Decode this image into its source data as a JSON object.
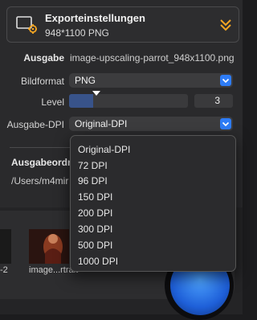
{
  "header": {
    "title": "Exporteinstellungen",
    "subtitle": "948*1100 PNG"
  },
  "ausgabe": {
    "label": "Ausgabe",
    "value": "image-upscaling-parrot_948x1100.png"
  },
  "bildformat": {
    "label": "Bildformat",
    "value": "PNG"
  },
  "level": {
    "label": "Level",
    "value": "3",
    "slider_fraction": 0.2
  },
  "dpi": {
    "label": "Ausgabe-DPI",
    "value": "Original-DPI",
    "options": [
      "Original-DPI",
      "72 DPI",
      "96 DPI",
      "150 DPI",
      "200 DPI",
      "300 DPI",
      "500 DPI",
      "1000 DPI"
    ]
  },
  "folder": {
    "label": "Ausgabeordn",
    "path": "/Users/m4mir"
  },
  "thumbs": {
    "label1": "-2",
    "label2": "image...rtrait"
  },
  "colors": {
    "accent": "#f5a623",
    "select_arrow": "#2e7cf6"
  }
}
